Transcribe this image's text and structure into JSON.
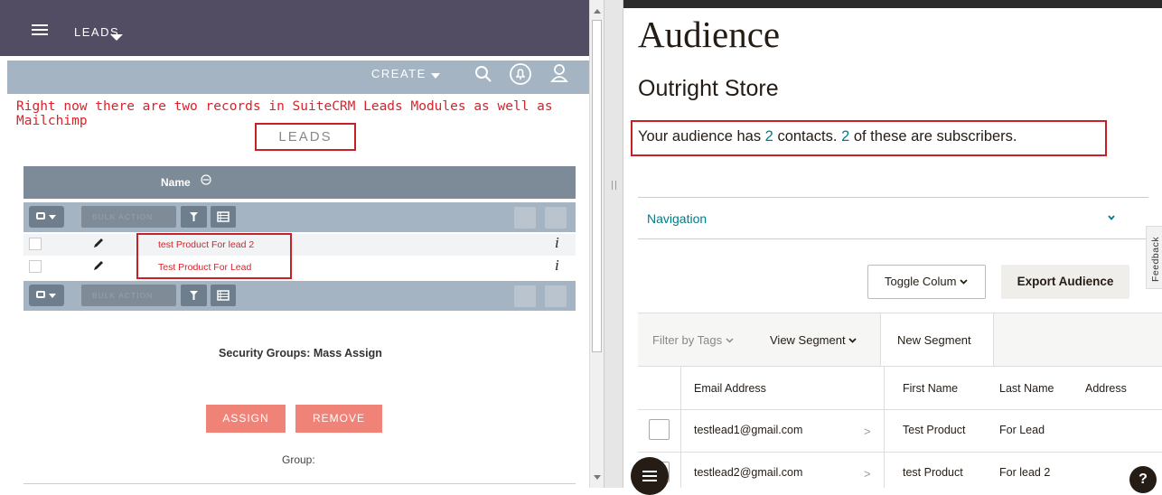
{
  "left": {
    "module_title": "LEADS",
    "create_label": "CREATE",
    "annotation": "Right now there are two records in SuiteCRM Leads Modules as well as Mailchimp",
    "leads_header": "LEADS",
    "name_column": "Name",
    "bulk_action_label": "BULK ACTION",
    "leads": [
      {
        "name": "test Product For lead 2"
      },
      {
        "name": "Test Product For Lead"
      }
    ],
    "info_glyph": "i",
    "security_groups_title": "Security Groups: Mass Assign",
    "assign_label": "ASSIGN",
    "remove_label": "REMOVE",
    "group_label": "Group:",
    "colors": {
      "topbar": "#534d64",
      "actionbar": "#a5b4c3",
      "accent_red": "#d8232a",
      "button_salmon": "#f08377"
    },
    "icons": [
      "hamburger-icon",
      "caret-down-icon",
      "search-icon",
      "notification-icon",
      "user-icon",
      "sort-icon",
      "checkbox-icon",
      "filter-icon",
      "columns-icon",
      "pencil-icon",
      "info-icon"
    ]
  },
  "right": {
    "title": "Audience",
    "store_name": "Outright Store",
    "summary": {
      "prefix": "Your audience has ",
      "contacts": "2",
      "middle": " contacts. ",
      "subscribers": "2",
      "suffix": " of these are subscribers."
    },
    "navigation_label": "Navigation",
    "feedback_label": "Feedback",
    "toggle_columns_label": "Toggle Colum",
    "export_label": "Export Audience",
    "filter_tags_label": "Filter by Tags",
    "view_segment_label": "View Segment",
    "new_segment_label": "New Segment",
    "columns": [
      "Email Address",
      "First Name",
      "Last Name",
      "Address"
    ],
    "rows": [
      {
        "email": "testlead1@gmail.com",
        "first": "Test Product",
        "last": "For Lead"
      },
      {
        "email": "testlead2@gmail.com",
        "first": "test Product",
        "last": "For lead 2"
      }
    ],
    "row_arrow": ">",
    "help_label": "?",
    "colors": {
      "teal": "#007c89",
      "text": "#241c15",
      "highlight_box": "#c72027"
    },
    "icons": [
      "chevron-down-icon",
      "chat-menu-icon",
      "help-icon"
    ]
  }
}
